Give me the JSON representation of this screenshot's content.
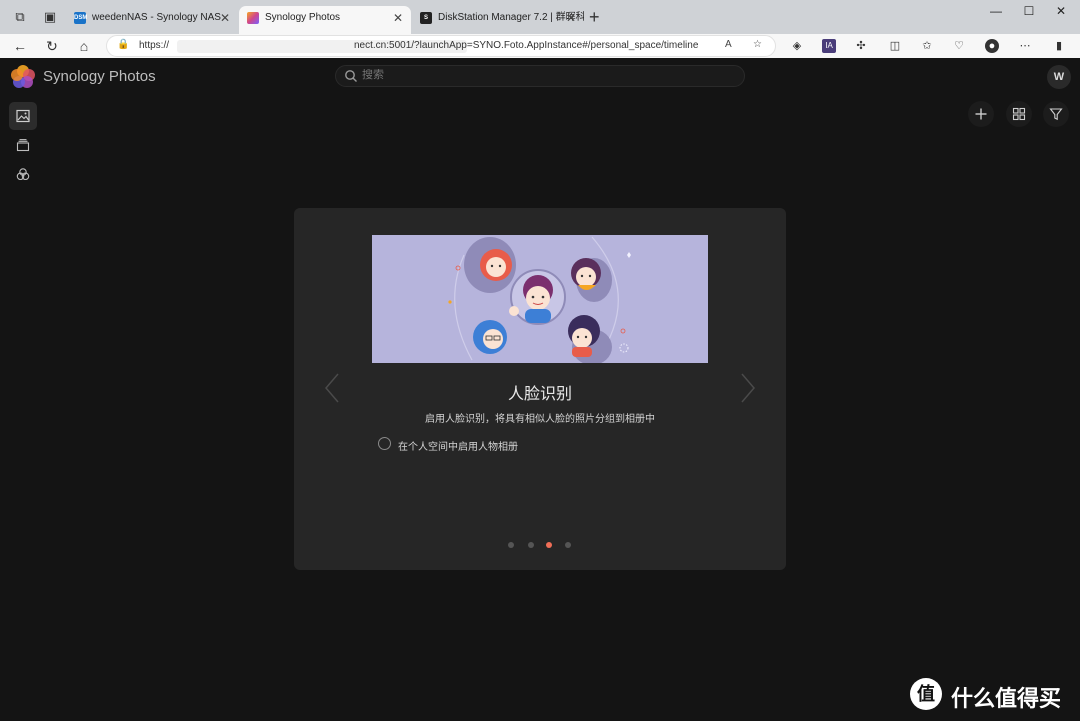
{
  "browser": {
    "tabs": [
      {
        "label": "weedenNAS - Synology NAS",
        "favicon": "DSM"
      },
      {
        "label": "Synology Photos",
        "favicon": ""
      },
      {
        "label": "DiskStation Manager 7.2 | 群晖科",
        "favicon": "S"
      }
    ],
    "url_prefix": "https://",
    "url_suffix": "nect.cn:5001/?launchApp=SYNO.Foto.AppInstance#/personal_space/timeline",
    "reader_mode": "A",
    "extension_label": "IA"
  },
  "app": {
    "title": "Synology Photos",
    "search_placeholder": "搜索",
    "avatar_initial": "W"
  },
  "dialog": {
    "title": "人脸识别",
    "description": "启用人脸识别，将具有相似人脸的照片分组到相册中",
    "option_label": "在个人空间中启用人物相册",
    "option_checked": false,
    "pages": 4,
    "current_page": 3
  },
  "watermark": {
    "logo_glyph": "值",
    "text": "什么值得买"
  },
  "colors": {
    "background": "#141414",
    "dialog": "#262626",
    "accent": "#f06e57",
    "illustration_bg": "#b6b4dc"
  }
}
